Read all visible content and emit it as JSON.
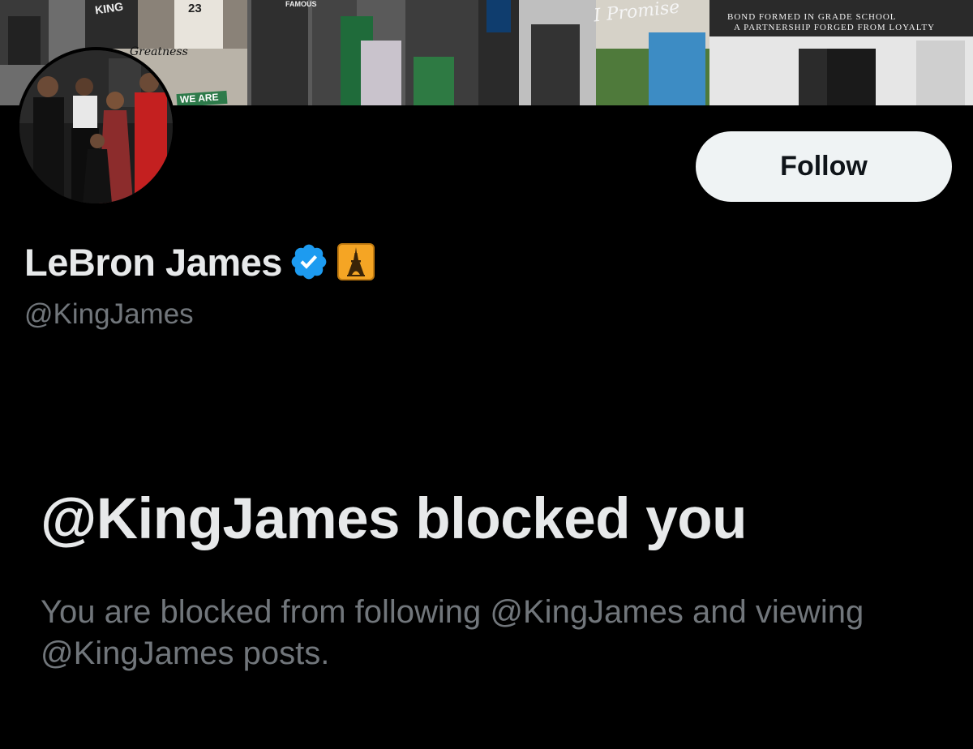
{
  "banner": {
    "caption_line_1": "BOND FORMED IN GRADE SCHOOL",
    "caption_line_2": "A PARTNERSHIP FORGED FROM LOYALTY",
    "script_text": "I Promise",
    "shirt_text_famous": "FAMOUS",
    "shirt_text_king": "KING",
    "jersey_number": "23",
    "sign_text": "WE ARE",
    "script_greatness": "Greatness"
  },
  "profile": {
    "display_name": "LeBron James",
    "handle": "@KingJames",
    "verified": true,
    "verified_icon": "verified-checkmark-icon",
    "badge_icon": "eiffel-tower-icon",
    "avatar_icon": "family-photo-avatar"
  },
  "actions": {
    "follow_label": "Follow"
  },
  "blocked": {
    "title": "@KingJames blocked you",
    "description": "You are blocked from following @KingJames and viewing @KingJames posts."
  },
  "colors": {
    "background": "#000000",
    "primary_text": "#e7e9ea",
    "secondary_text": "#71767b",
    "button_bg": "#eff3f4",
    "button_text": "#0f1419",
    "verified_blue": "#1d9bf0",
    "badge_orange": "#f5a524"
  }
}
